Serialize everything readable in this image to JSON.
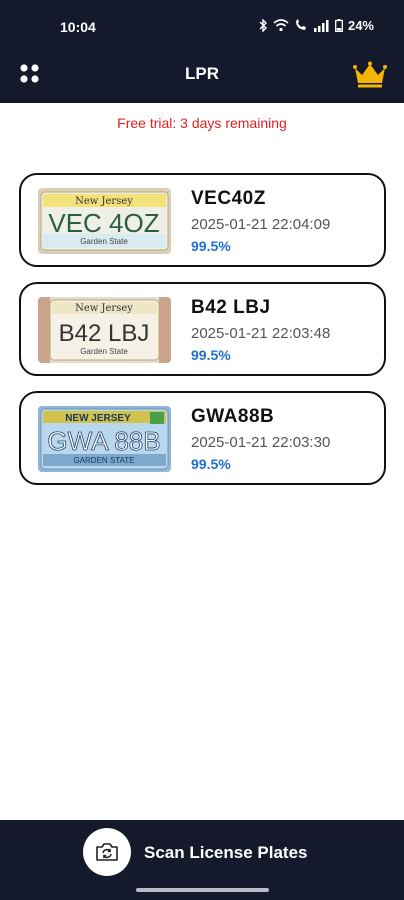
{
  "status_bar": {
    "time": "10:04",
    "battery": "24%",
    "icons": [
      "bluetooth-icon",
      "wifi-icon",
      "wifi-calling-icon",
      "signal-icon",
      "battery-icon"
    ]
  },
  "app_bar": {
    "title": "LPR",
    "menu_icon": "dots-grid-icon",
    "premium_icon": "crown-icon"
  },
  "trial_banner": "Free trial: 3 days remaining",
  "plates": [
    {
      "code": "VEC40Z",
      "timestamp": "2025-01-21 22:04:09",
      "confidence": "99.5%",
      "image": {
        "state": "New Jersey",
        "plate_text": "VEC 4OZ",
        "motto": "Garden State"
      }
    },
    {
      "code": "B42 LBJ",
      "timestamp": "2025-01-21 22:03:48",
      "confidence": "99.5%",
      "image": {
        "state": "New Jersey",
        "plate_text": "B42 LBJ",
        "motto": "Garden State"
      }
    },
    {
      "code": "GWA88B",
      "timestamp": "2025-01-21 22:03:30",
      "confidence": "99.5%",
      "image": {
        "state": "NEW JERSEY",
        "plate_text": "GWA 88B",
        "motto": "GARDEN STATE"
      }
    }
  ],
  "bottom_bar": {
    "scan_label": "Scan License Plates",
    "scan_icon": "camera-switch-icon"
  },
  "colors": {
    "bar_bg": "#141a2c",
    "trial_text": "#e02020",
    "confidence_text": "#1f6fd0",
    "crown": "#f5b400"
  }
}
